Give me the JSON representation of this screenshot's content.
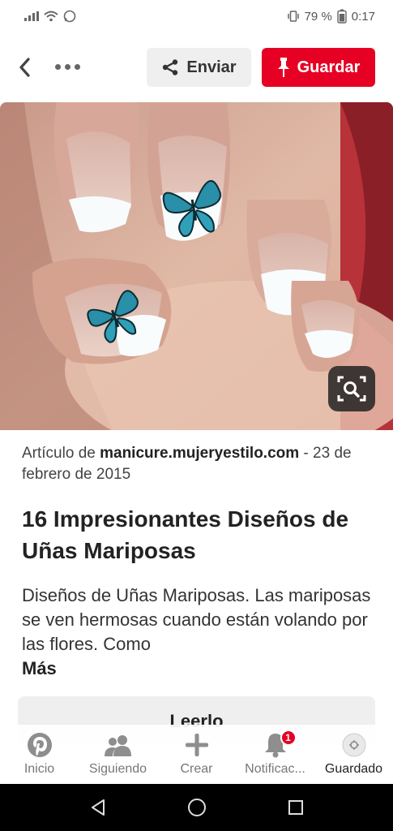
{
  "status_bar": {
    "battery": "79 %",
    "time": "0:17"
  },
  "header": {
    "share_label": "Enviar",
    "save_label": "Guardar"
  },
  "pin": {
    "attribution_prefix": "Artículo de ",
    "attribution_source": "manicure.mujeryestilo.com",
    "attribution_suffix": " - 23 de febrero de 2015",
    "title": "16 Impresionantes Diseños de Uñas Mariposas",
    "description": "Diseños de Uñas Mariposas. Las mariposas se ven hermosas cuando están volando por las flores. Como",
    "more_label": "Más",
    "read_button": "Leerlo"
  },
  "tabs": [
    {
      "label": "Inicio",
      "icon": "pinterest-icon"
    },
    {
      "label": "Siguiendo",
      "icon": "people-icon"
    },
    {
      "label": "Crear",
      "icon": "plus-icon"
    },
    {
      "label": "Notificac...",
      "icon": "bell-icon",
      "badge": "1"
    },
    {
      "label": "Guardado",
      "icon": "profile-icon"
    }
  ],
  "colors": {
    "brand_red": "#e60023",
    "button_gray": "#efefef"
  }
}
